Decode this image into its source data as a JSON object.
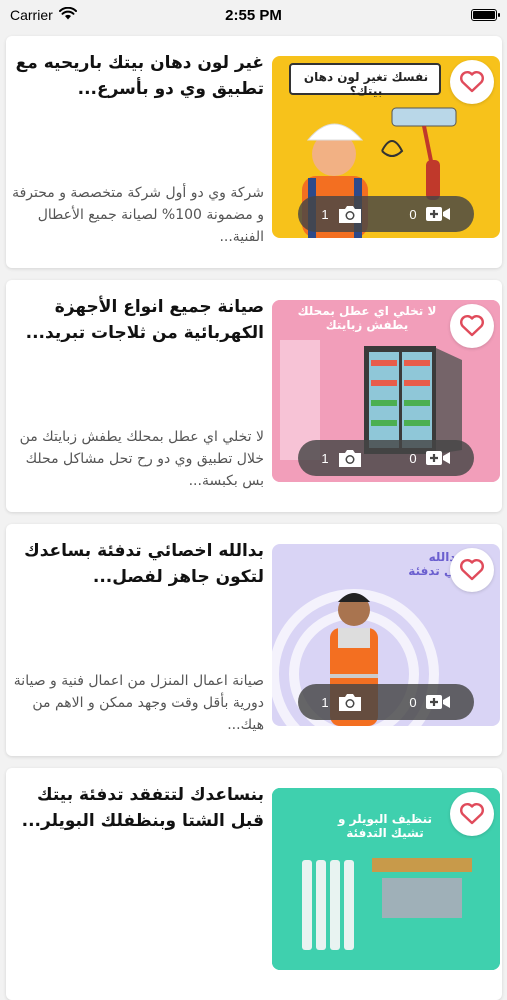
{
  "status_bar": {
    "carrier": "Carrier",
    "time": "2:55 PM"
  },
  "colors": {
    "heart": "#e04b5b",
    "card_bg": "#ffffff",
    "pill_bg": "#464646"
  },
  "cards": [
    {
      "title": "غير لون دهان بيتك باريحيه مع تطبيق وي دو بأسرع...",
      "description": "شركة وي دو أول شركة متخصصة و محترفة و مضمونة 100% لصيانة جميع الأعطال الفنية...",
      "video_count": "0",
      "photo_count": "1",
      "image_caption": "نفسك تغير لون دهان بيتك؟",
      "thumb_color": "#f7c21b"
    },
    {
      "title": "صيانة جميع انواع الأجهزة الكهربائية من ثلاجات تبريد...",
      "description": "لا تخلي اي عطل بمحلك يطفش زبايتك من خلال تطبيق وي دو رح تحل مشاكل محلك بس بكبسة...",
      "video_count": "0",
      "photo_count": "1",
      "image_caption": "لا تخلي اي عطل بمحلك يطفش زبايتك",
      "thumb_color": "#ef8fb0"
    },
    {
      "title": "بدالله اخصائي تدفئة بساعدك لتكون جاهز لفصل...",
      "description": "صيانة اعمال المنزل من اعمال فنية و صيانة دورية بأقل وقت وجهد ممكن و الاهم من هيك...",
      "video_count": "0",
      "photo_count": "1",
      "image_caption": "عبدالله اخصائي تدفئة",
      "thumb_color": "#d9d4f5"
    },
    {
      "title": "بنساعدك لتتفقد تدفئة بيتك قبل الشتا وبنظفلك البويلر...",
      "description": "",
      "video_count": "0",
      "photo_count": "1",
      "image_caption": "تنظيف البويلر و تشيك التدفئة",
      "thumb_color": "#2fbfa0"
    }
  ]
}
